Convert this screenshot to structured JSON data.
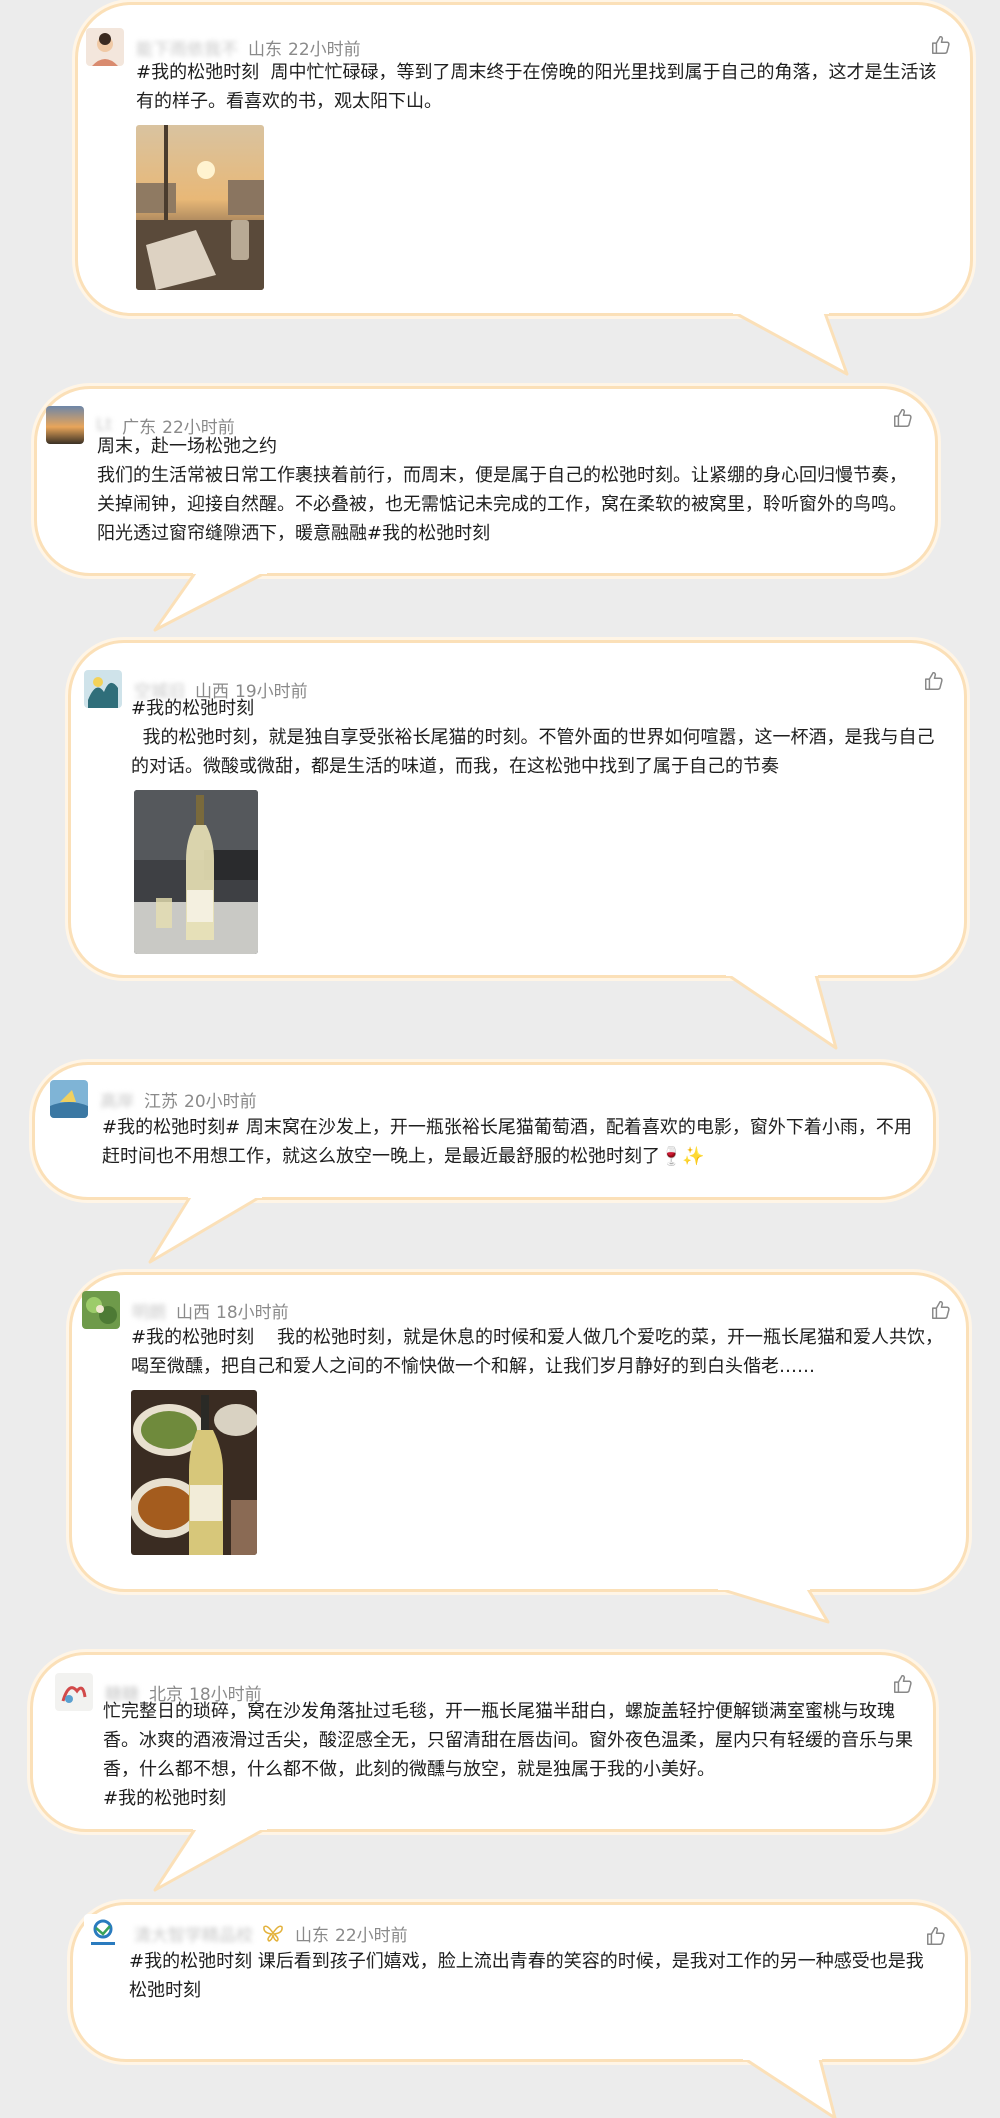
{
  "posts": [
    {
      "username": "能下雨依我不",
      "location": "山东",
      "time": "22小时前",
      "text": "#我的松弛时刻  周中忙忙碌碌，等到了周末终于在傍晚的阳光里找到属于自己的角落，这才是生活该有的样子。看喜欢的书，观太阳下山。",
      "photo": "sunset-reading-photo"
    },
    {
      "username": "Lt",
      "location": "广东",
      "time": "22小时前",
      "text": "周末，赴一场松弛之约\n我们的生活常被日常工作裹挟着前行，而周末，便是属于自己的松弛时刻。让紧绷的身心回归慢节奏，关掉闹钟，迎接自然醒。不必叠被，也无需惦记未完成的工作，窝在柔软的被窝里，聆听窗外的鸟鸣。阳光透过窗帘缝隙洒下，暖意融融#我的松弛时刻"
    },
    {
      "username": "空城旧",
      "location": "山西",
      "time": "19小时前",
      "text": "#我的松弛时刻\n  我的松弛时刻，就是独自享受张裕长尾猫的时刻。不管外面的世界如何喧嚣，这一杯酒，是我与自己的对话。微酸或微甜，都是生活的味道，而我，在这松弛中找到了属于自己的节奏",
      "photo": "wine-bottle-photo"
    },
    {
      "username": "高岸",
      "location": "江苏",
      "time": "20小时前",
      "text": "#我的松弛时刻# 周末窝在沙发上，开一瓶张裕长尾猫葡萄酒，配着喜欢的电影，窗外下着小雨，不用赶时间也不用想工作，就这么放空一晚上，是最近最舒服的松弛时刻了🍷✨"
    },
    {
      "username": "明朗",
      "location": "山西",
      "time": "18小时前",
      "text": "#我的松弛时刻    我的松弛时刻，就是休息的时候和爱人做几个爱吃的菜，开一瓶长尾猫和爱人共饮，喝至微醺，把自己和爱人之间的不愉快做一个和解，让我们岁月静好的到白头偕老……",
      "photo": "dinner-wine-photo"
    },
    {
      "username": "糖糖",
      "location": "北京",
      "time": "18小时前",
      "text": "忙完整日的琐碎，窝在沙发角落扯过毛毯，开一瓶长尾猫半甜白，螺旋盖轻拧便解锁满室蜜桃与玫瑰香。冰爽的酒液滑过舌尖，酸涩感全无，只留清甜在唇齿间。窗外夜色温柔，屋内只有轻缓的音乐与果香，什么都不想，什么都不做，此刻的微醺与放空，就是独属于我的小美好。\n#我的松弛时刻"
    },
    {
      "username": "清大智学精品校",
      "location": "山东",
      "time": "22小时前",
      "text": "#我的松弛时刻 课后看到孩子们嬉戏，脸上流出青春的笑容的时候，是我对工作的另一种感受也是我松弛时刻"
    }
  ],
  "icons": {
    "like": "thumbs-up-icon",
    "badge": "butterfly-badge-icon"
  },
  "colors": {
    "border": "#fbe0b8",
    "background": "#ececec",
    "text": "#1e1e1e",
    "meta": "#8a8a8a"
  }
}
